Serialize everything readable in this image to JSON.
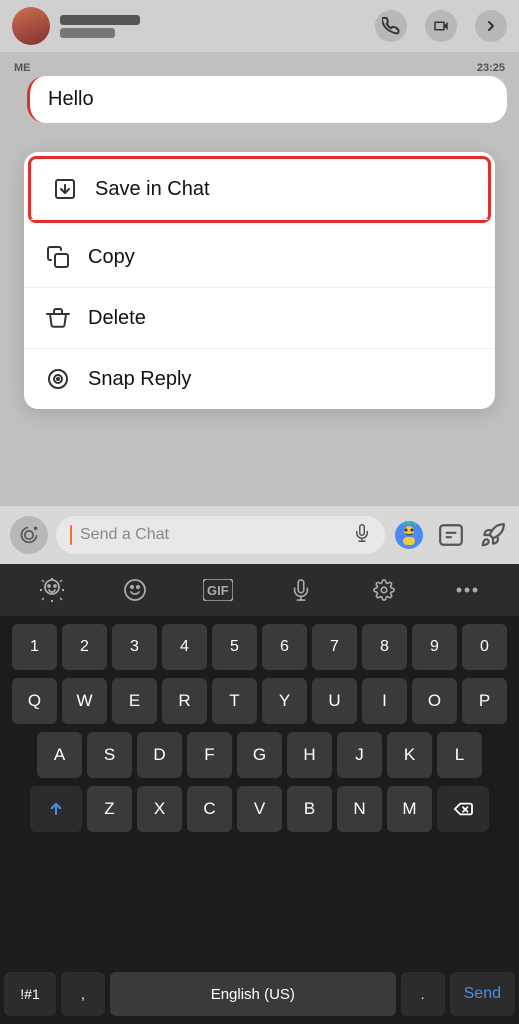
{
  "topBar": {
    "contactName": "·····",
    "phoneIcon": "phone",
    "videoIcon": "video",
    "chevronIcon": "chevron-right"
  },
  "message": {
    "sender": "ME",
    "timestamp": "23:25",
    "text": "Hello"
  },
  "contextMenu": {
    "items": [
      {
        "id": "save-in-chat",
        "label": "Save in Chat",
        "icon": "save",
        "highlighted": true
      },
      {
        "id": "copy",
        "label": "Copy",
        "icon": "copy",
        "highlighted": false
      },
      {
        "id": "delete",
        "label": "Delete",
        "icon": "delete",
        "highlighted": false
      },
      {
        "id": "snap-reply",
        "label": "Snap Reply",
        "icon": "camera",
        "highlighted": false
      }
    ]
  },
  "chatInput": {
    "placeholder": "Send a Chat"
  },
  "keyboard": {
    "toolbar": {
      "icons": [
        "emoji",
        "smiley",
        "gif",
        "mic",
        "settings",
        "more"
      ]
    },
    "rows": {
      "numbers": [
        "1",
        "2",
        "3",
        "4",
        "5",
        "6",
        "7",
        "8",
        "9",
        "0"
      ],
      "row1": [
        "Q",
        "W",
        "E",
        "R",
        "T",
        "Y",
        "U",
        "I",
        "O",
        "P"
      ],
      "row2": [
        "A",
        "S",
        "D",
        "F",
        "G",
        "H",
        "J",
        "K",
        "L"
      ],
      "row3": [
        "Z",
        "X",
        "C",
        "V",
        "B",
        "N",
        "M"
      ]
    },
    "bottomRow": {
      "symbolLabel": "!#1",
      "commaLabel": ",",
      "spaceLang": "English (US)",
      "periodLabel": ".",
      "sendLabel": "Send"
    }
  }
}
